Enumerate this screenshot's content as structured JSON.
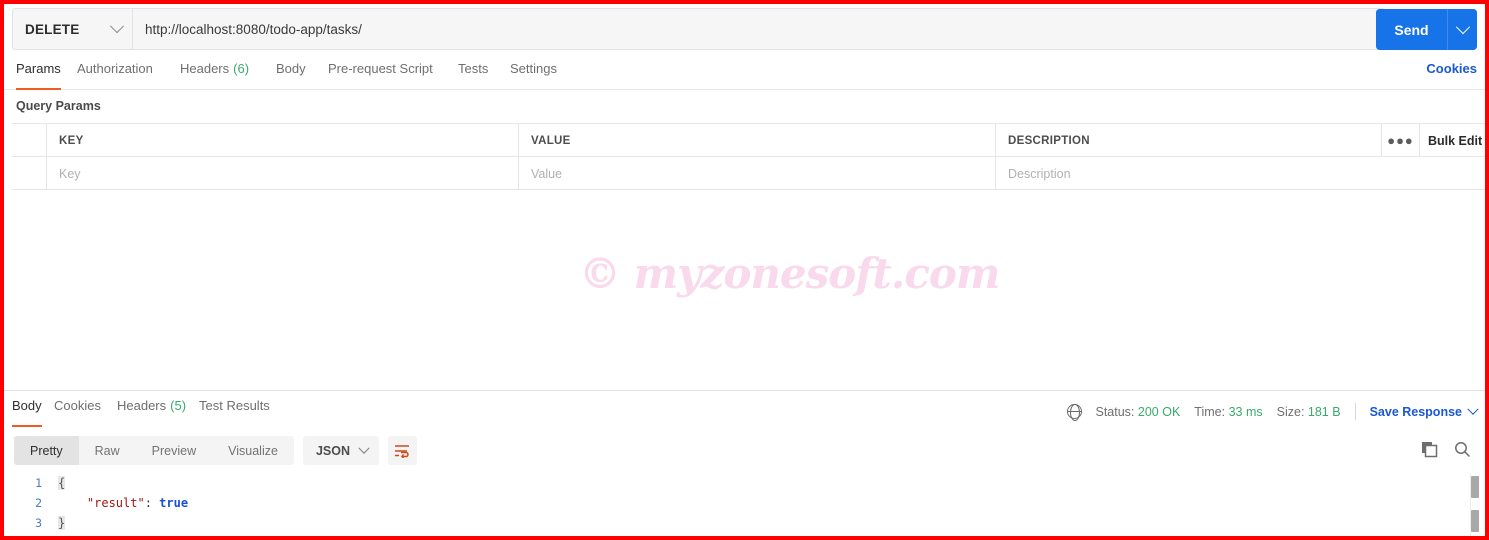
{
  "request": {
    "method": "DELETE",
    "url": "http://localhost:8080/todo-app/tasks/",
    "send_label": "Send",
    "tabs": [
      {
        "label": "Params",
        "count": null,
        "active": true
      },
      {
        "label": "Authorization",
        "count": null,
        "active": false
      },
      {
        "label": "Headers",
        "count": "(6)",
        "active": false
      },
      {
        "label": "Body",
        "count": null,
        "active": false
      },
      {
        "label": "Pre-request Script",
        "count": null,
        "active": false
      },
      {
        "label": "Tests",
        "count": null,
        "active": false
      },
      {
        "label": "Settings",
        "count": null,
        "active": false
      }
    ],
    "cookies_label": "Cookies"
  },
  "query_params": {
    "section_label": "Query Params",
    "headers": [
      "KEY",
      "VALUE",
      "DESCRIPTION"
    ],
    "more_glyph": "●●●",
    "bulk_edit_label": "Bulk Edit",
    "rows": [
      {
        "key_placeholder": "Key",
        "value_placeholder": "Value",
        "description_placeholder": "Description"
      }
    ]
  },
  "watermark": {
    "text": "© myzonesoft.com",
    "color": "#f9d9ec"
  },
  "response": {
    "tabs": [
      {
        "label": "Body",
        "count": null,
        "active": true
      },
      {
        "label": "Cookies",
        "count": null,
        "active": false
      },
      {
        "label": "Headers",
        "count": "(5)",
        "active": false
      },
      {
        "label": "Test Results",
        "count": null,
        "active": false
      }
    ],
    "status": {
      "status_label": "Status:",
      "status_value": "200 OK",
      "time_label": "Time:",
      "time_value": "33 ms",
      "size_label": "Size:",
      "size_value": "181 B"
    },
    "save_response_label": "Save Response",
    "format_tabs": [
      {
        "label": "Pretty",
        "active": true
      },
      {
        "label": "Raw",
        "active": false
      },
      {
        "label": "Preview",
        "active": false
      },
      {
        "label": "Visualize",
        "active": false
      }
    ],
    "language": "JSON",
    "body_lines": [
      {
        "num": "1",
        "text": "{"
      },
      {
        "num": "2",
        "text": "    \"result\": true"
      },
      {
        "num": "3",
        "text": "}"
      }
    ],
    "body_json": {
      "key": "\"result\"",
      "colon": ": ",
      "value": "true",
      "open_brace": "{",
      "close_brace": "}"
    }
  },
  "colors": {
    "accent_orange": "#ef5b25",
    "link_blue": "#1a58d6",
    "send_blue": "#1774e8",
    "status_green": "#3aaa6d",
    "frame_red": "#fe0000"
  }
}
